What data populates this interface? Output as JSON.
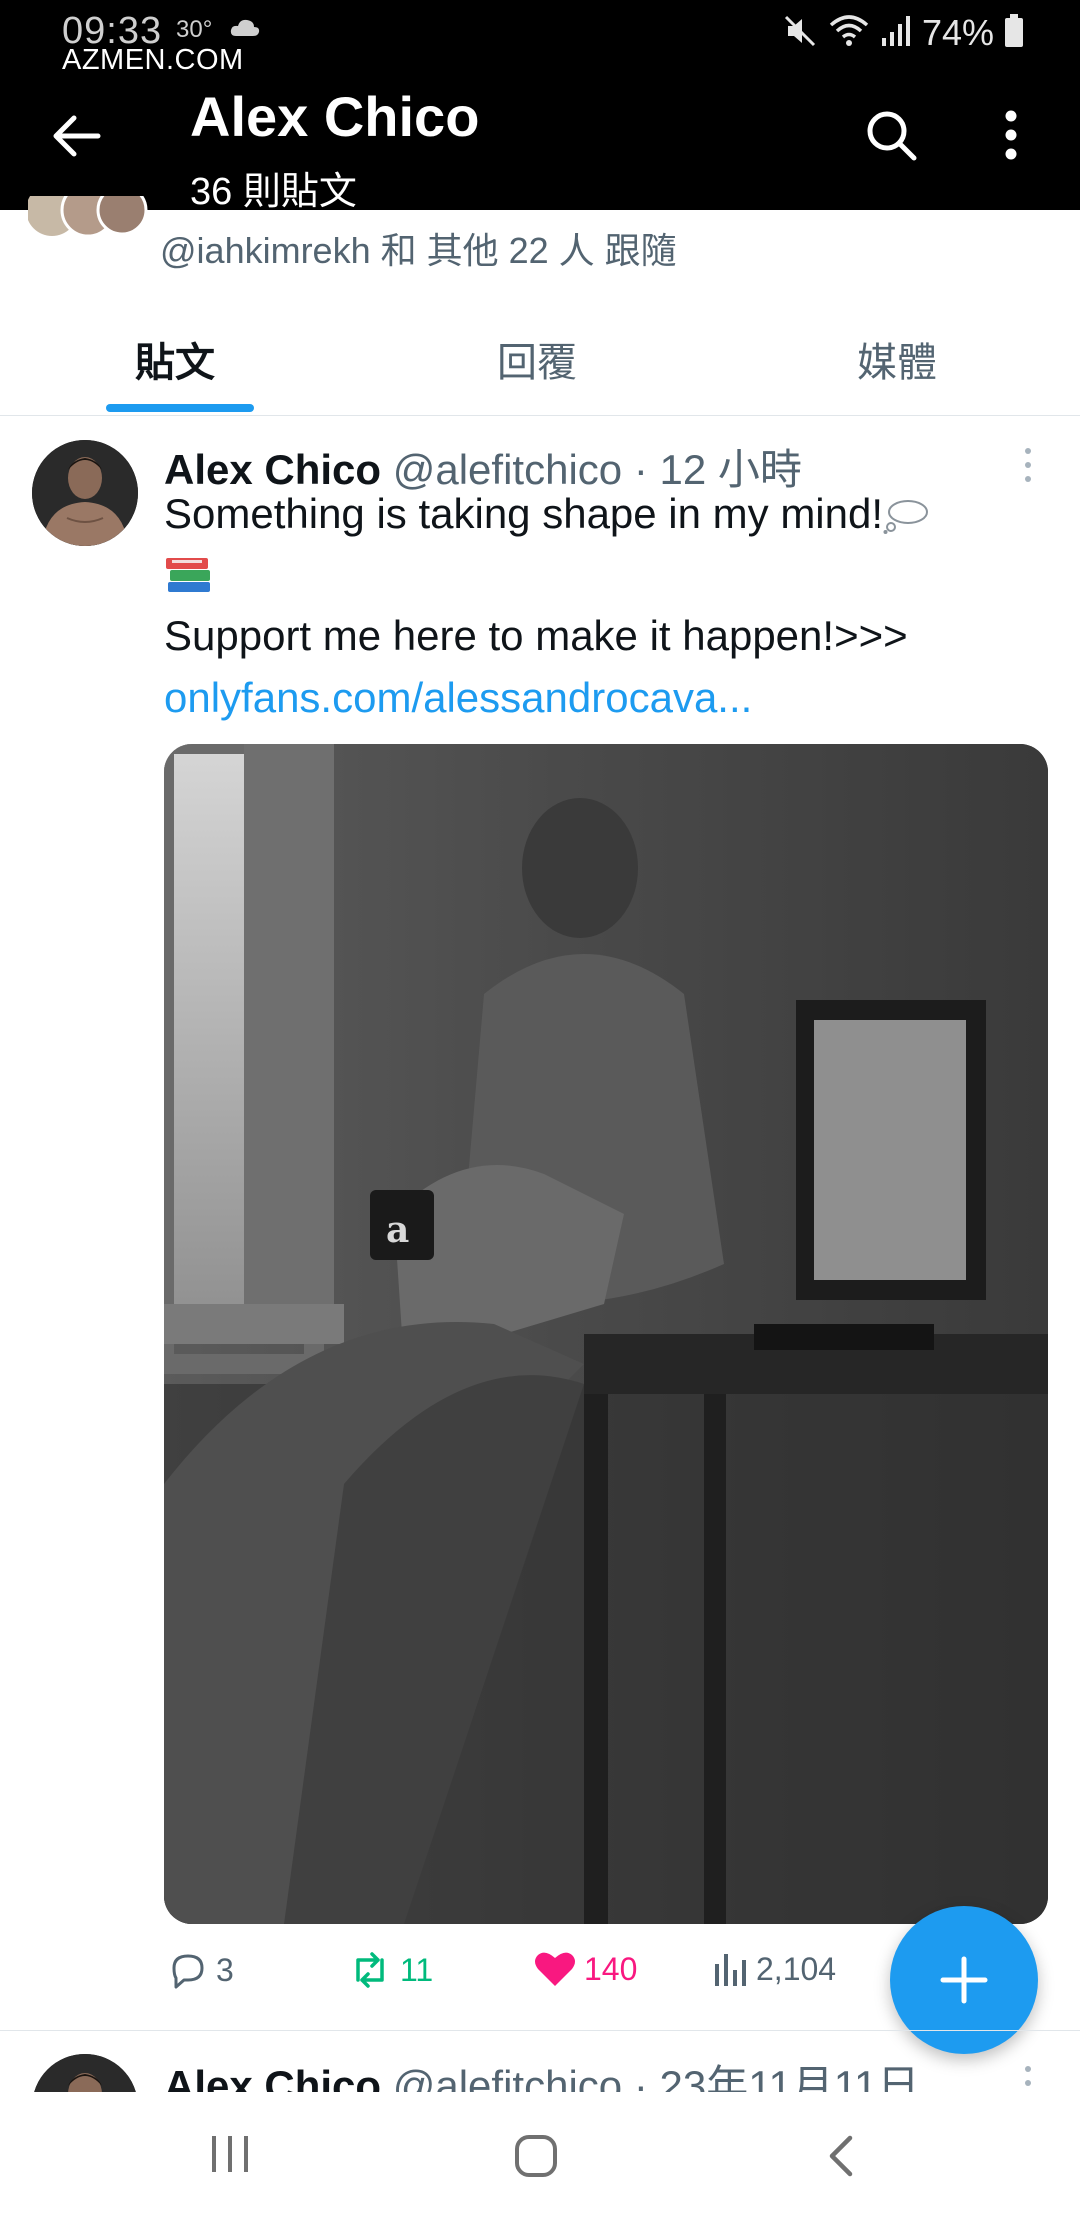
{
  "status_bar": {
    "time": "09:33",
    "temperature": "30°",
    "battery": "74%"
  },
  "watermark": "AZMEN.COM",
  "header": {
    "title": "Alex Chico",
    "subtitle": "36 則貼文"
  },
  "followers": {
    "text": "@iahkimrekh 和 其他 22 人 跟隨"
  },
  "tabs": [
    {
      "label": "貼文",
      "active": true
    },
    {
      "label": "回覆",
      "active": false
    },
    {
      "label": "媒體",
      "active": false
    }
  ],
  "tweet": {
    "name": "Alex Chico",
    "handle": "@alefitchico",
    "sep": "·",
    "time": "12 小時",
    "line1": "Something is taking shape in my mind!",
    "line2": "Support me here to make it happen!>>>",
    "link": "onlyfans.com/alessandrocava...",
    "stats": {
      "replies": "3",
      "reposts": "11",
      "likes": "140",
      "views": "2,104"
    }
  },
  "tweet2": {
    "name": "Alex Chico",
    "handle": "@alefitchico",
    "sep": "·",
    "time": "23年11月11日"
  },
  "colors": {
    "accent": "#1d9bf0",
    "repost": "#00ba7c",
    "like": "#f91880",
    "muted": "#536471"
  }
}
